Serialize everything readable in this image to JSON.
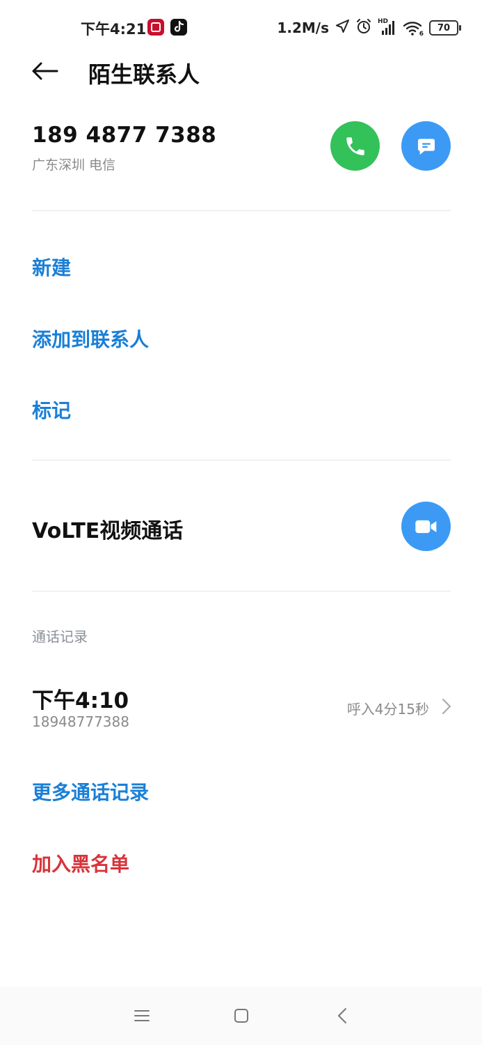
{
  "status_bar": {
    "time": "下午4:21",
    "net_speed": "1.2M/s",
    "battery": "70",
    "signal_badge": "HD",
    "wifi_badge": "6"
  },
  "header": {
    "title": "陌生联系人"
  },
  "contact": {
    "number": "189 4877 7388",
    "location": "广东深圳 电信"
  },
  "actions": {
    "new": "新建",
    "add_to_contacts": "添加到联系人",
    "mark": "标记"
  },
  "volte": {
    "label": "VoLTE视频通话"
  },
  "call_log": {
    "section_title": "通话记录",
    "entries": [
      {
        "time": "下午4:10",
        "number": "18948777388",
        "detail": "呼入4分15秒"
      }
    ],
    "more": "更多通话记录"
  },
  "blacklist": {
    "label": "加入黑名单"
  },
  "colors": {
    "link": "#1a7fd6",
    "danger": "#d8333a",
    "call_green": "#33c15a",
    "accent_blue": "#3c9af5"
  }
}
